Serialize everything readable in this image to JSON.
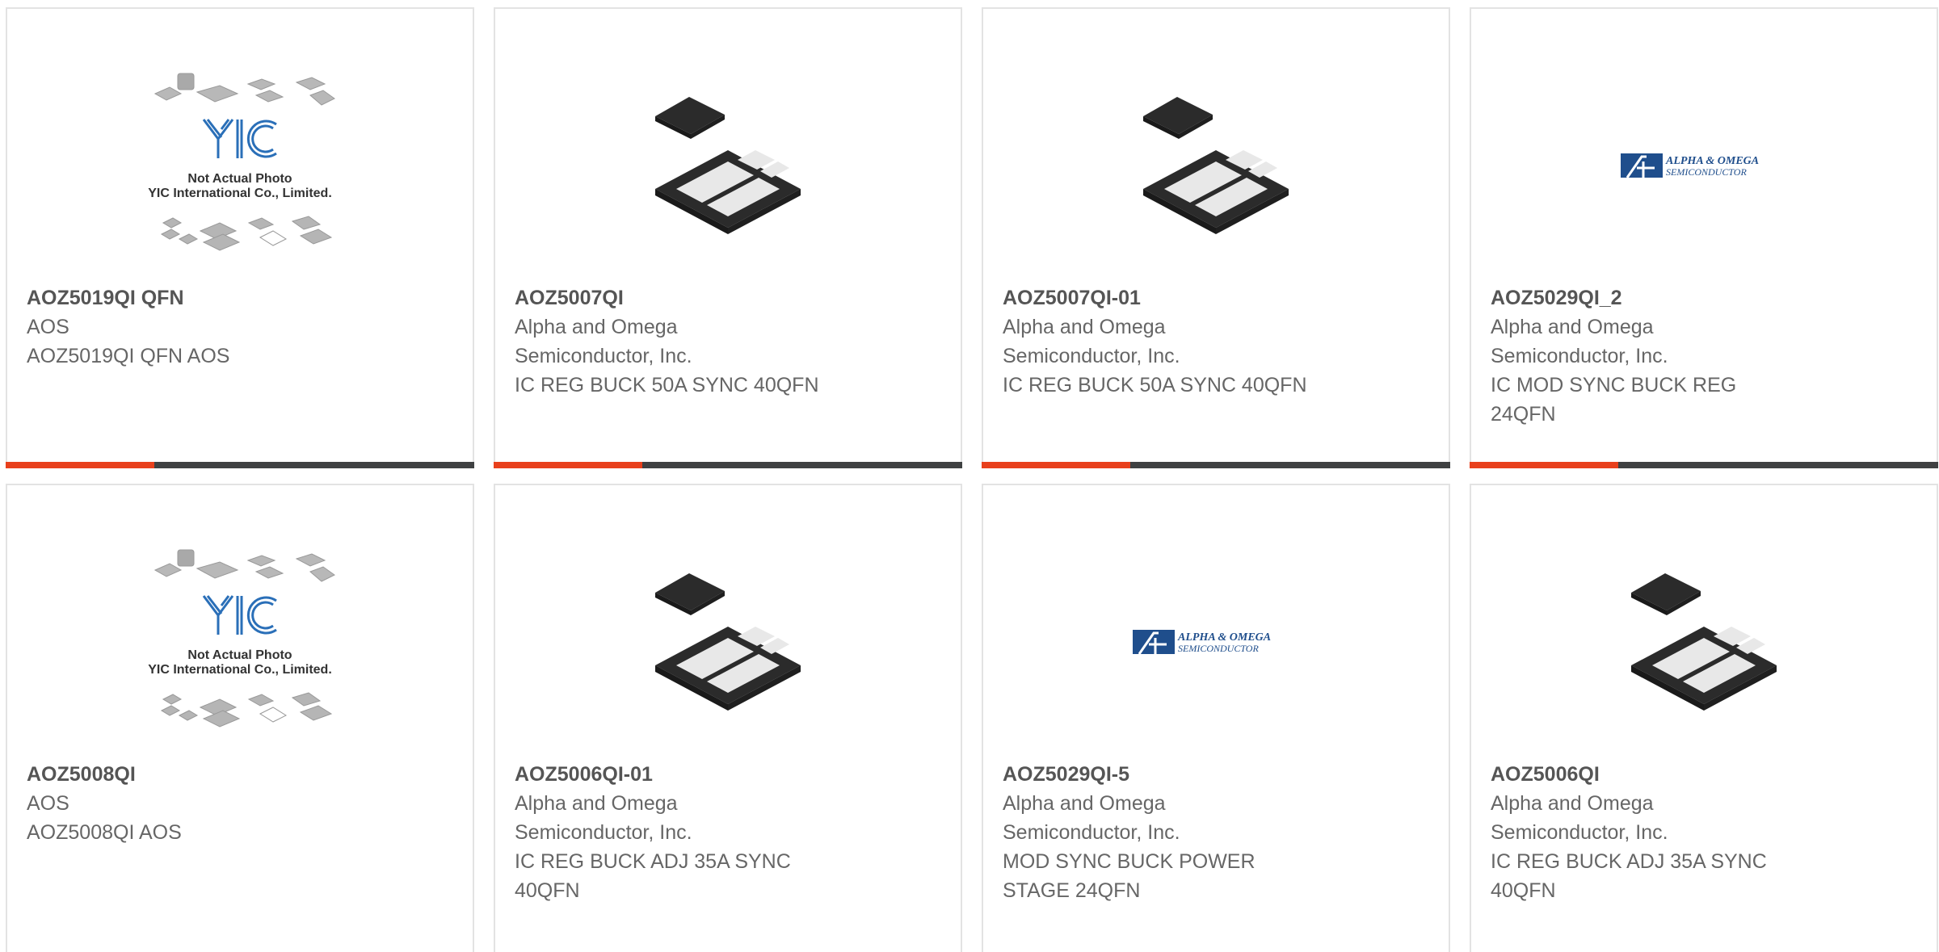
{
  "products": [
    {
      "part_number": "AOZ5019QI QFN",
      "manufacturer": "AOS",
      "description": "AOZ5019QI QFN AOS",
      "image": "yic-placeholder",
      "placeholder_text": [
        "Not Actual Photo",
        "YIC International Co., Limited."
      ],
      "logo_text": "YIC"
    },
    {
      "part_number": "AOZ5007QI",
      "manufacturer": "Alpha and Omega Semiconductor, Inc.",
      "description": "IC REG BUCK 50A SYNC 40QFN",
      "image": "qfn-chip"
    },
    {
      "part_number": "AOZ5007QI-01",
      "manufacturer": "Alpha and Omega Semiconductor, Inc.",
      "description": "IC REG BUCK 50A SYNC 40QFN",
      "image": "qfn-chip"
    },
    {
      "part_number": "AOZ5029QI_2",
      "manufacturer": "Alpha and Omega Semiconductor, Inc.",
      "description": "IC MOD SYNC BUCK REG 24QFN",
      "image": "aos-logo",
      "logo_lines": [
        "ALPHA & OMEGA",
        "SEMICONDUCTOR"
      ]
    },
    {
      "part_number": "AOZ5008QI",
      "manufacturer": "AOS",
      "description": "AOZ5008QI AOS",
      "image": "yic-placeholder",
      "placeholder_text": [
        "Not Actual Photo",
        "YIC International Co., Limited."
      ],
      "logo_text": "YIC"
    },
    {
      "part_number": "AOZ5006QI-01",
      "manufacturer": "Alpha and Omega Semiconductor, Inc.",
      "description": "IC REG BUCK ADJ 35A SYNC 40QFN",
      "image": "qfn-chip"
    },
    {
      "part_number": "AOZ5029QI-5",
      "manufacturer": "Alpha and Omega Semiconductor, Inc.",
      "description": "MOD SYNC BUCK POWER STAGE 24QFN",
      "image": "aos-logo",
      "logo_lines": [
        "ALPHA & OMEGA",
        "SEMICONDUCTOR"
      ]
    },
    {
      "part_number": "AOZ5006QI",
      "manufacturer": "Alpha and Omega Semiconductor, Inc.",
      "description": "IC REG BUCK ADJ 35A SYNC 40QFN",
      "image": "qfn-chip"
    }
  ],
  "colors": {
    "accent_bar": "#e8401c",
    "dark_bar": "#3f4142",
    "card_border": "#e3e3e3",
    "text_bold": "#555555",
    "text": "#666666",
    "yic_blue": "#2a6fb8",
    "aos_blue": "#1f4e8c"
  }
}
